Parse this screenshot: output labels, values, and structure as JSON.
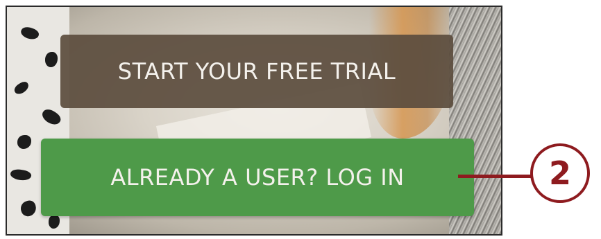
{
  "buttons": {
    "trial_label": "START YOUR FREE TRIAL",
    "login_label": "ALREADY A USER? LOG IN"
  },
  "callout": {
    "number": "2"
  },
  "colors": {
    "trial_button": "#5c4e3e",
    "login_button": "#4e9a49",
    "callout": "#8e1b1f"
  }
}
